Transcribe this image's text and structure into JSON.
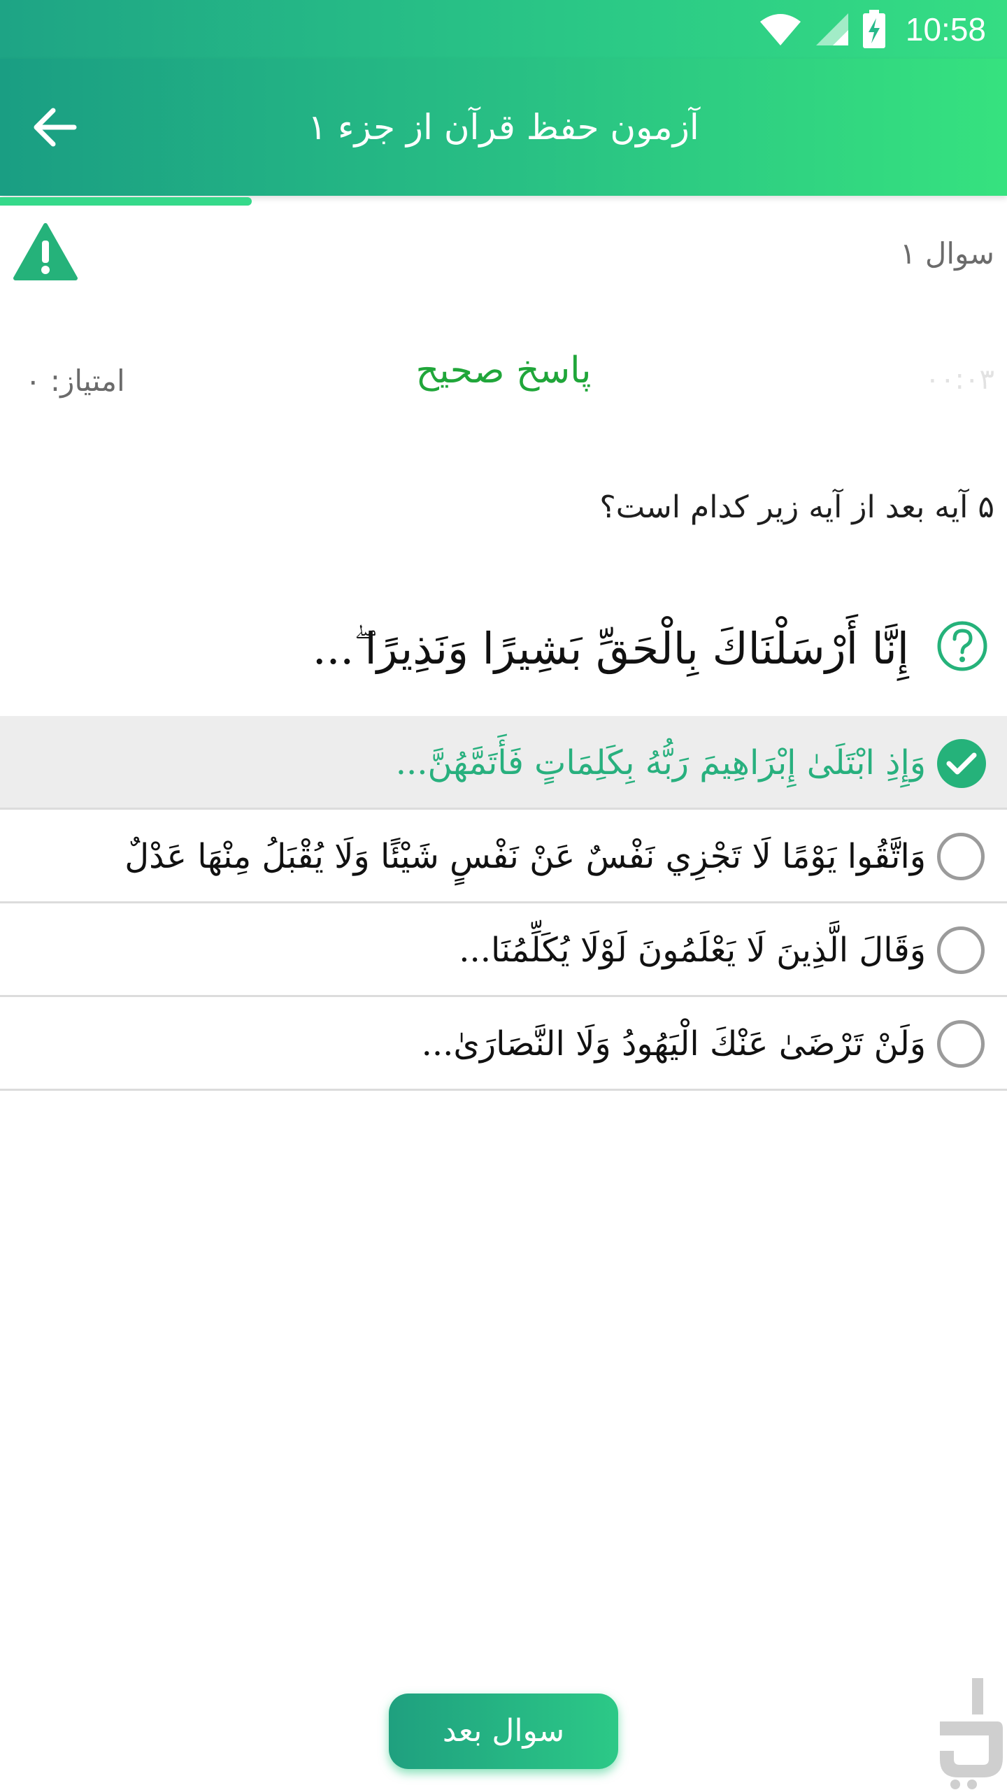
{
  "status_bar": {
    "time": "10:58",
    "icons": [
      "wifi-icon",
      "signal-icon",
      "battery-charging-icon"
    ]
  },
  "app_bar": {
    "title": "آزمون حفظ قرآن از جزء ۱",
    "back_icon": "arrow-left-icon"
  },
  "quiz": {
    "question_number": "سوال ۱",
    "timer": "۰۰:۰۳",
    "result_label": "پاسخ صحیح",
    "score": "امتیاز: ۰",
    "question_text": "۵ آیه بعد از آیه زیر کدام است؟",
    "verse": "إِنَّا أَرْسَلْنَاكَ بِالْحَقِّ بَشِيرًا وَنَذِيرًا ۖ...",
    "options": [
      {
        "text": "وَإِذِ ابْتَلَىٰ إِبْرَاهِيمَ رَبُّهُ بِكَلِمَاتٍ فَأَتَمَّهُنَّ...",
        "selected": true
      },
      {
        "text": "وَاتَّقُوا يَوْمًا لَا تَجْزِي نَفْسٌ عَنْ نَفْسٍ شَيْئًا وَلَا يُقْبَلُ مِنْهَا عَدْلٌ",
        "selected": false
      },
      {
        "text": "وَقَالَ الَّذِينَ لَا يَعْلَمُونَ لَوْلَا يُكَلِّمُنَا...",
        "selected": false
      },
      {
        "text": "وَلَنْ تَرْضَىٰ عَنْكَ الْيَهُودُ وَلَا النَّصَارَىٰ...",
        "selected": false
      }
    ]
  },
  "footer": {
    "next_button_label": "سوال بعد"
  },
  "colors": {
    "accent": "#28bf84",
    "correct_text": "#20a63a",
    "selected_option_text": "#28b07e"
  }
}
